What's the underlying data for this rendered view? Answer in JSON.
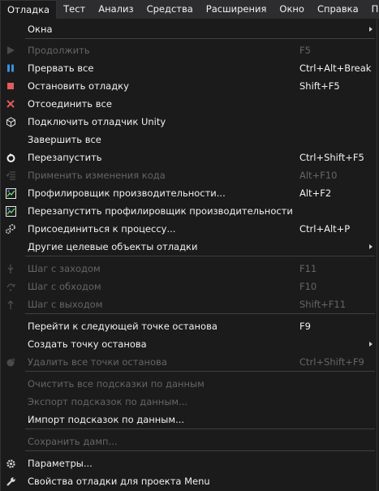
{
  "menubar": [
    {
      "label": "Отладка",
      "active": true
    },
    {
      "label": "Тест"
    },
    {
      "label": "Анализ"
    },
    {
      "label": "Средства"
    },
    {
      "label": "Расширения"
    },
    {
      "label": "Окно"
    },
    {
      "label": "Справка"
    },
    {
      "label": "П"
    }
  ],
  "menu": [
    {
      "label": "Окна",
      "submenu": true
    },
    {
      "label": "Продолжить",
      "shortcut": "F5",
      "disabled": true,
      "icon": "play-icon"
    },
    {
      "label": "Прервать все",
      "shortcut": "Ctrl+Alt+Break",
      "icon": "pause-icon"
    },
    {
      "label": "Остановить отладку",
      "shortcut": "Shift+F5",
      "icon": "stop-icon"
    },
    {
      "label": "Отсоединить все",
      "icon": "detach-icon"
    },
    {
      "label": "Подключить отладчик Unity",
      "icon": "unity-icon"
    },
    {
      "label": "Завершить все"
    },
    {
      "label": "Перезапустить",
      "shortcut": "Ctrl+Shift+F5",
      "icon": "restart-icon"
    },
    {
      "label": "Применить изменения кода",
      "shortcut": "Alt+F10",
      "disabled": true,
      "icon": "apply-code-changes-icon"
    },
    {
      "label": "Профилировщик производительности...",
      "shortcut": "Alt+F2",
      "icon": "profiler-icon"
    },
    {
      "label": "Перезапустить профилировщик производительности",
      "icon": "profiler-restart-icon"
    },
    {
      "label": "Присоединиться к процессу...",
      "shortcut": "Ctrl+Alt+P",
      "icon": "attach-process-icon"
    },
    {
      "label": "Другие целевые объекты отладки",
      "submenu": true
    },
    {
      "label": "Шаг с заходом",
      "shortcut": "F11",
      "disabled": true,
      "icon": "step-into-icon"
    },
    {
      "label": "Шаг с обходом",
      "shortcut": "F10",
      "disabled": true,
      "icon": "step-over-icon"
    },
    {
      "label": "Шаг с выходом",
      "shortcut": "Shift+F11",
      "disabled": true,
      "icon": "step-out-icon"
    },
    {
      "label": "Перейти к следующей точке останова",
      "shortcut": "F9"
    },
    {
      "label": "Создать точку останова",
      "submenu": true
    },
    {
      "label": "Удалить все точки останова",
      "shortcut": "Ctrl+Shift+F9",
      "disabled": true,
      "icon": "delete-breakpoints-icon"
    },
    {
      "label": "Очистить все подсказки по данным",
      "disabled": true
    },
    {
      "label": "Экспорт подсказок по данным...",
      "disabled": true
    },
    {
      "label": "Импорт подсказок по данным..."
    },
    {
      "label": "Сохранить дамп...",
      "disabled": true
    },
    {
      "label": "Параметры...",
      "icon": "gear-icon"
    },
    {
      "label": "Свойства отладки для проекта Menu",
      "icon": "wrench-icon"
    }
  ],
  "colors": {
    "accent_blue": "#3c8fdb",
    "stop_red": "#e45b5b",
    "disabled": "#656565"
  }
}
